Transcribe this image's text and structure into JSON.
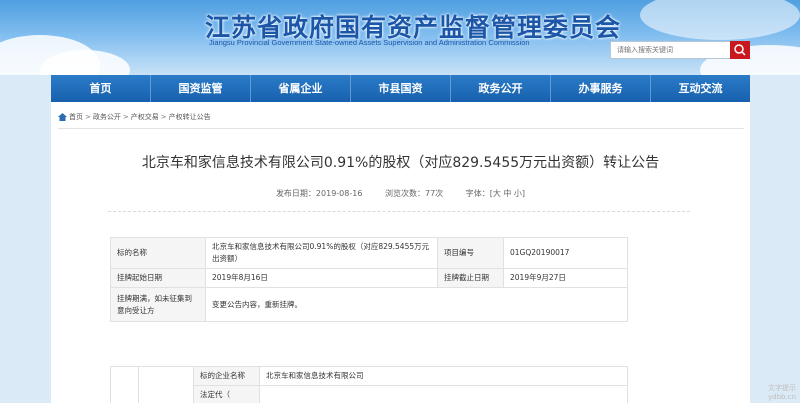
{
  "header": {
    "title": "江苏省政府国有资产监督管理委员会",
    "subtitle": "Jiangsu Provincial Government State-owned Assets Supervision and Administration Commission",
    "search_placeholder": "请输入搜索关键词",
    "accent": "#1a66b3",
    "search_button_color": "#c8171e"
  },
  "nav": [
    "首页",
    "国资监管",
    "省属企业",
    "市县国资",
    "政务公开",
    "办事服务",
    "互动交流"
  ],
  "breadcrumb": [
    "首页",
    "政务公开",
    "产权交易",
    "产权转让公告"
  ],
  "article": {
    "title": "北京车和家信息技术有限公司0.91%的股权（对应829.5455万元出资额）转让公告",
    "publish_date": "发布日期：2019-08-16",
    "views": "浏览次数：77次",
    "font_size": "字体：[大 中 小]"
  },
  "table1": [
    [
      "标的名称",
      "北京车和家信息技术有限公司0.91%的股权（对应829.5455万元出资额）",
      "项目编号",
      "01GQ20190017"
    ],
    [
      "挂牌起始日期",
      "2019年8月16日",
      "挂牌截止日期",
      "2019年9月27日"
    ],
    [
      "挂牌期满，如未征集到意向受让方",
      "变更公告内容，重新挂牌。"
    ]
  ],
  "table2": [
    [
      "标的企业名称",
      "北京车和家信息技术有限公司"
    ],
    [
      "法定代（",
      ""
    ]
  ],
  "watermark": [
    "文字提示",
    "ydbb.cn"
  ]
}
